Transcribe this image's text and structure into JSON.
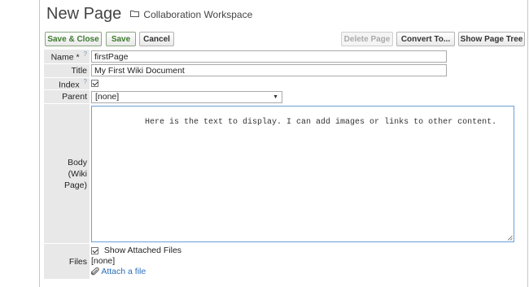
{
  "header": {
    "title": "New Page",
    "workspace": "Collaboration Workspace"
  },
  "toolbar": {
    "save_close": "Save & Close",
    "save": "Save",
    "cancel": "Cancel",
    "delete_page": "Delete Page",
    "convert_to": "Convert To...",
    "show_page_tree": "Show Page Tree"
  },
  "form": {
    "name_label": "Name",
    "name_required": "*",
    "help_mark": "?",
    "name_value": "firstPage",
    "title_label": "Title",
    "title_value": "My First Wiki Document",
    "index_label": "Index",
    "index_checked": true,
    "parent_label": "Parent",
    "parent_value": "[none]",
    "body_label_line1": "Body",
    "body_label_line2": "(Wiki",
    "body_label_line3": "Page)",
    "body_value": "Here is the text to display. I can add images or links to other content.",
    "files_label": "Files",
    "show_attached_label": "Show Attached Files",
    "show_attached_checked": true,
    "files_value": "[none]",
    "attach_link": "Attach a file"
  },
  "colors": {
    "green_button_text": "#3d7a2d",
    "label_bg": "#e8e8e8",
    "body_border": "#6aa0d8",
    "link": "#2a6fb8"
  }
}
